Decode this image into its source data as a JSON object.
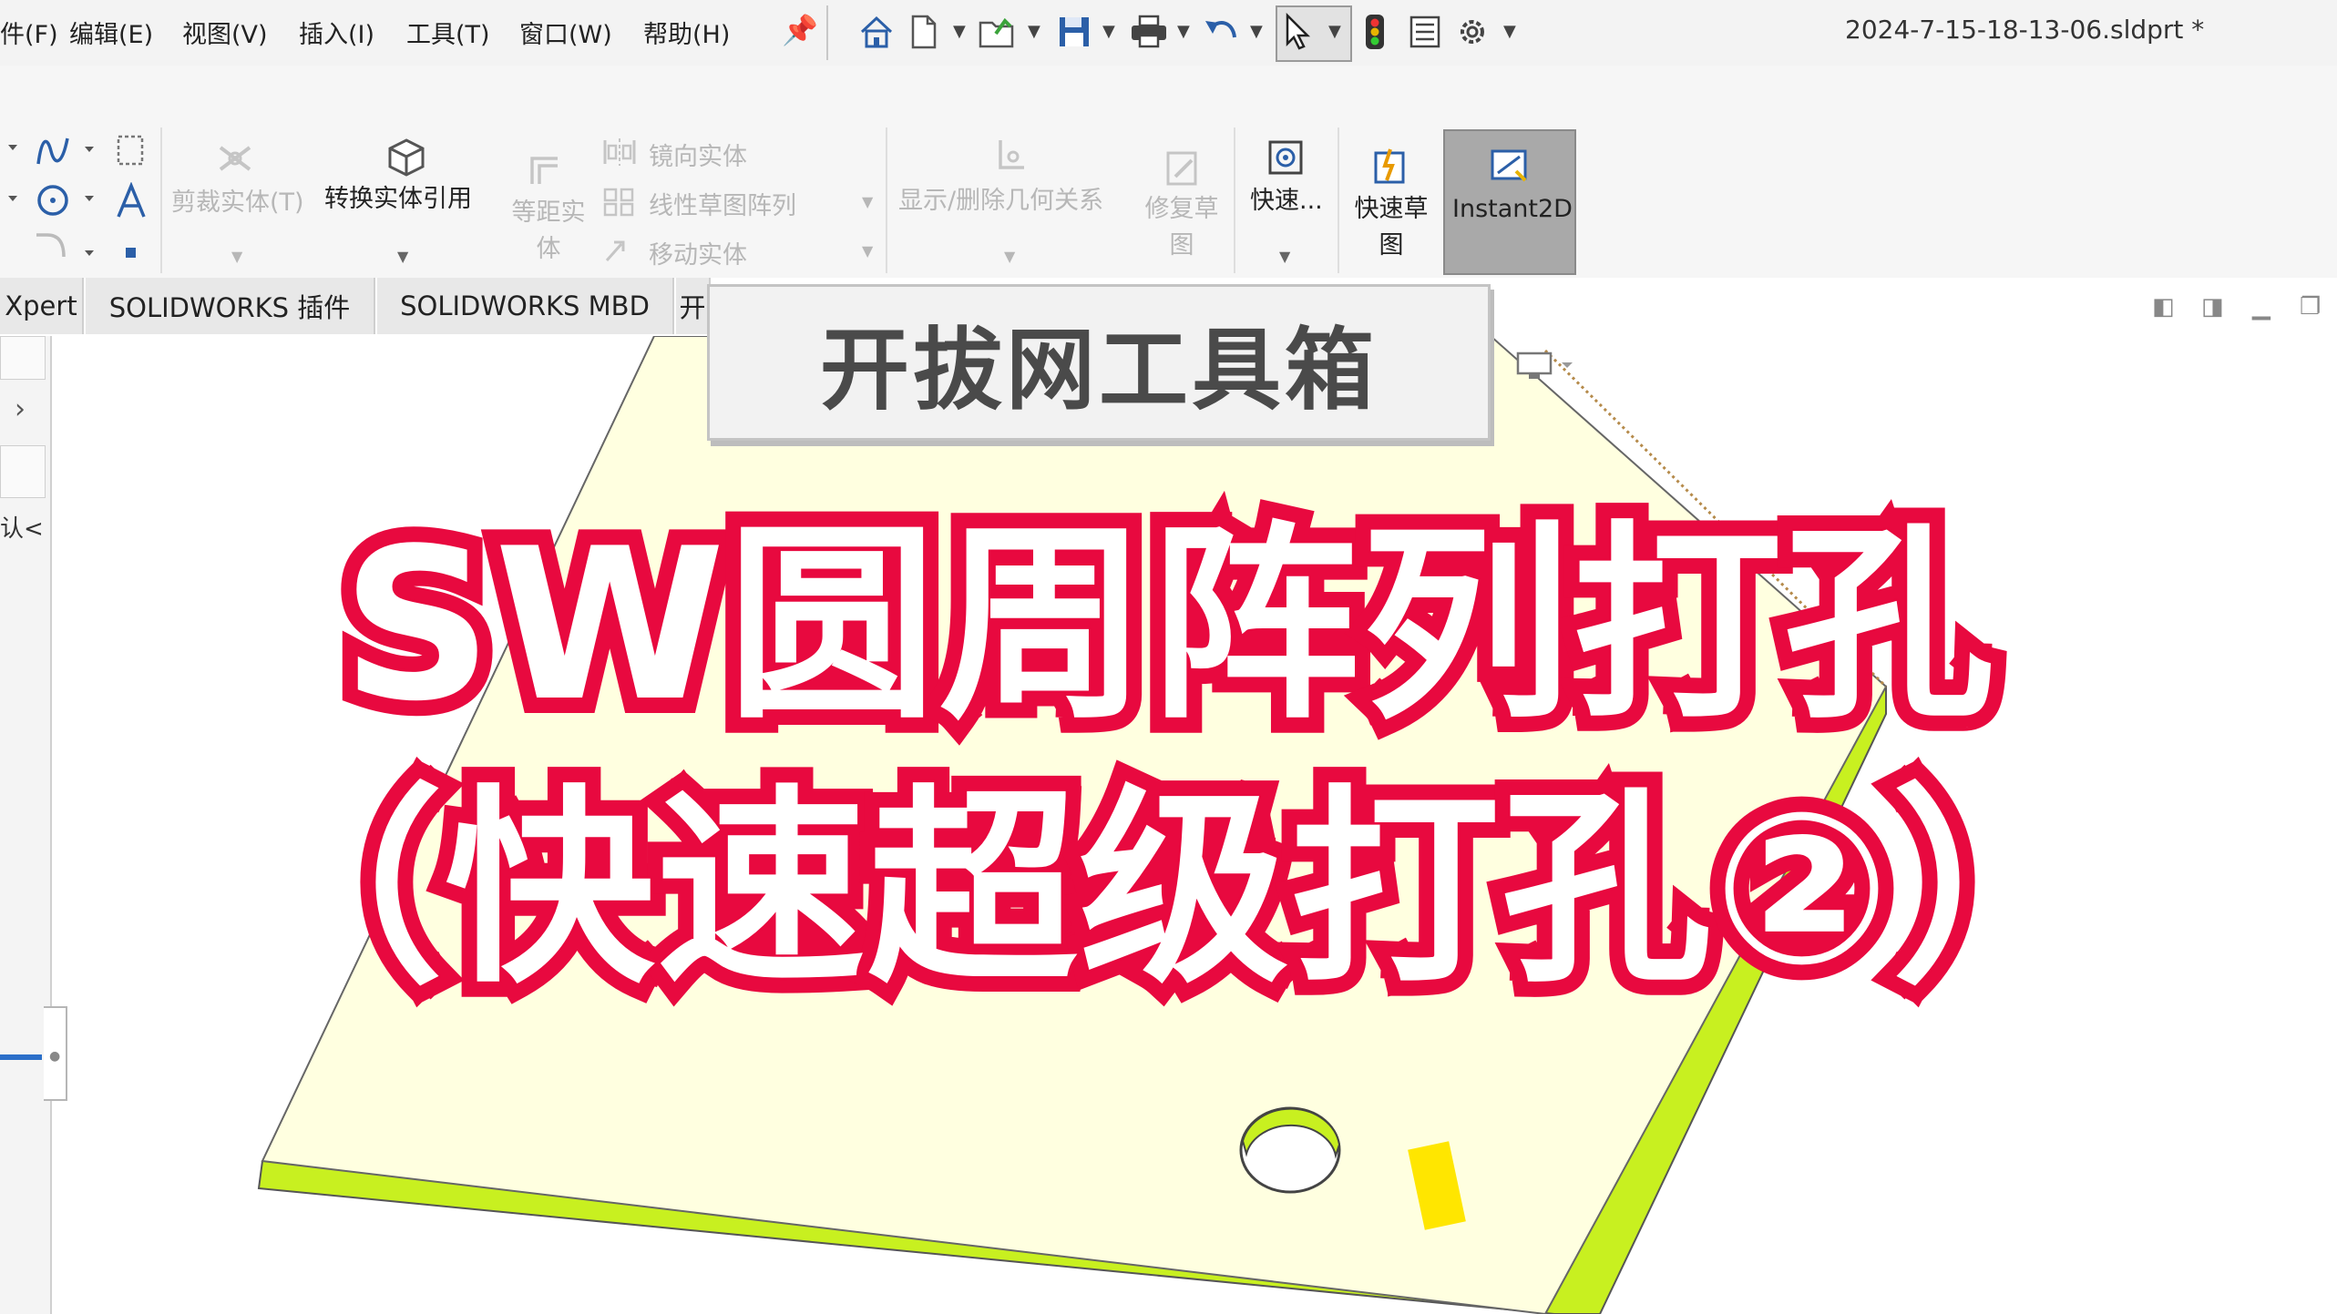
{
  "menu": {
    "items": [
      "件(F)",
      "编辑(E)",
      "视图(V)",
      "插入(I)",
      "工具(T)",
      "窗口(W)",
      "帮助(H)"
    ]
  },
  "document": {
    "title": "2024-7-15-18-13-06.sldprt *"
  },
  "ribbon": {
    "trim": "剪裁实体(T)",
    "convert": "转换实体引用",
    "offset": "等距实体",
    "mirror": "镜向实体",
    "linear_pattern": "线性草图阵列",
    "move": "移动实体",
    "relations": "显示/删除几何关系",
    "repair": "修复草图",
    "quick_snaps": "快速...",
    "rapid_sketch": "快速草图",
    "instant2d": "Instant2D"
  },
  "tabs": [
    "Xpert",
    "SOLIDWORKS 插件",
    "SOLIDWORKS MBD",
    "开"
  ],
  "left_panel": {
    "text": "认<"
  },
  "watermark": {
    "text": "开拔网工具箱"
  },
  "overlay": {
    "line1": "SW圆周阵列打孔",
    "line2": "（快速超级打孔②）"
  },
  "colors": {
    "headline_stroke": "#e8093f",
    "plate_face": "#ffffe0",
    "plate_edge": "#c8f020",
    "instant2d_active": "#a9a9a9"
  },
  "icons": [
    "home-icon",
    "new-file-icon",
    "open-file-icon",
    "save-icon",
    "print-icon",
    "undo-icon",
    "select-arrow-icon",
    "traffic-light-icon",
    "options-icon",
    "gear-icon",
    "pin-icon"
  ]
}
